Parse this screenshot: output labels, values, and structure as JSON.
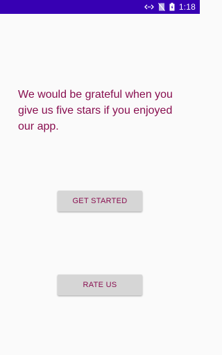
{
  "status_bar": {
    "time": "1:18",
    "icons": [
      "data-sync-icon",
      "no-sim-icon",
      "battery-charging-icon"
    ],
    "background": "#3700b3"
  },
  "main": {
    "message": "We would be grateful when you give us five stars if you enjoyed our app.",
    "text_color": "#880e4f"
  },
  "buttons": {
    "get_started_label": "GET STARTED",
    "rate_us_label": "RATE US"
  }
}
